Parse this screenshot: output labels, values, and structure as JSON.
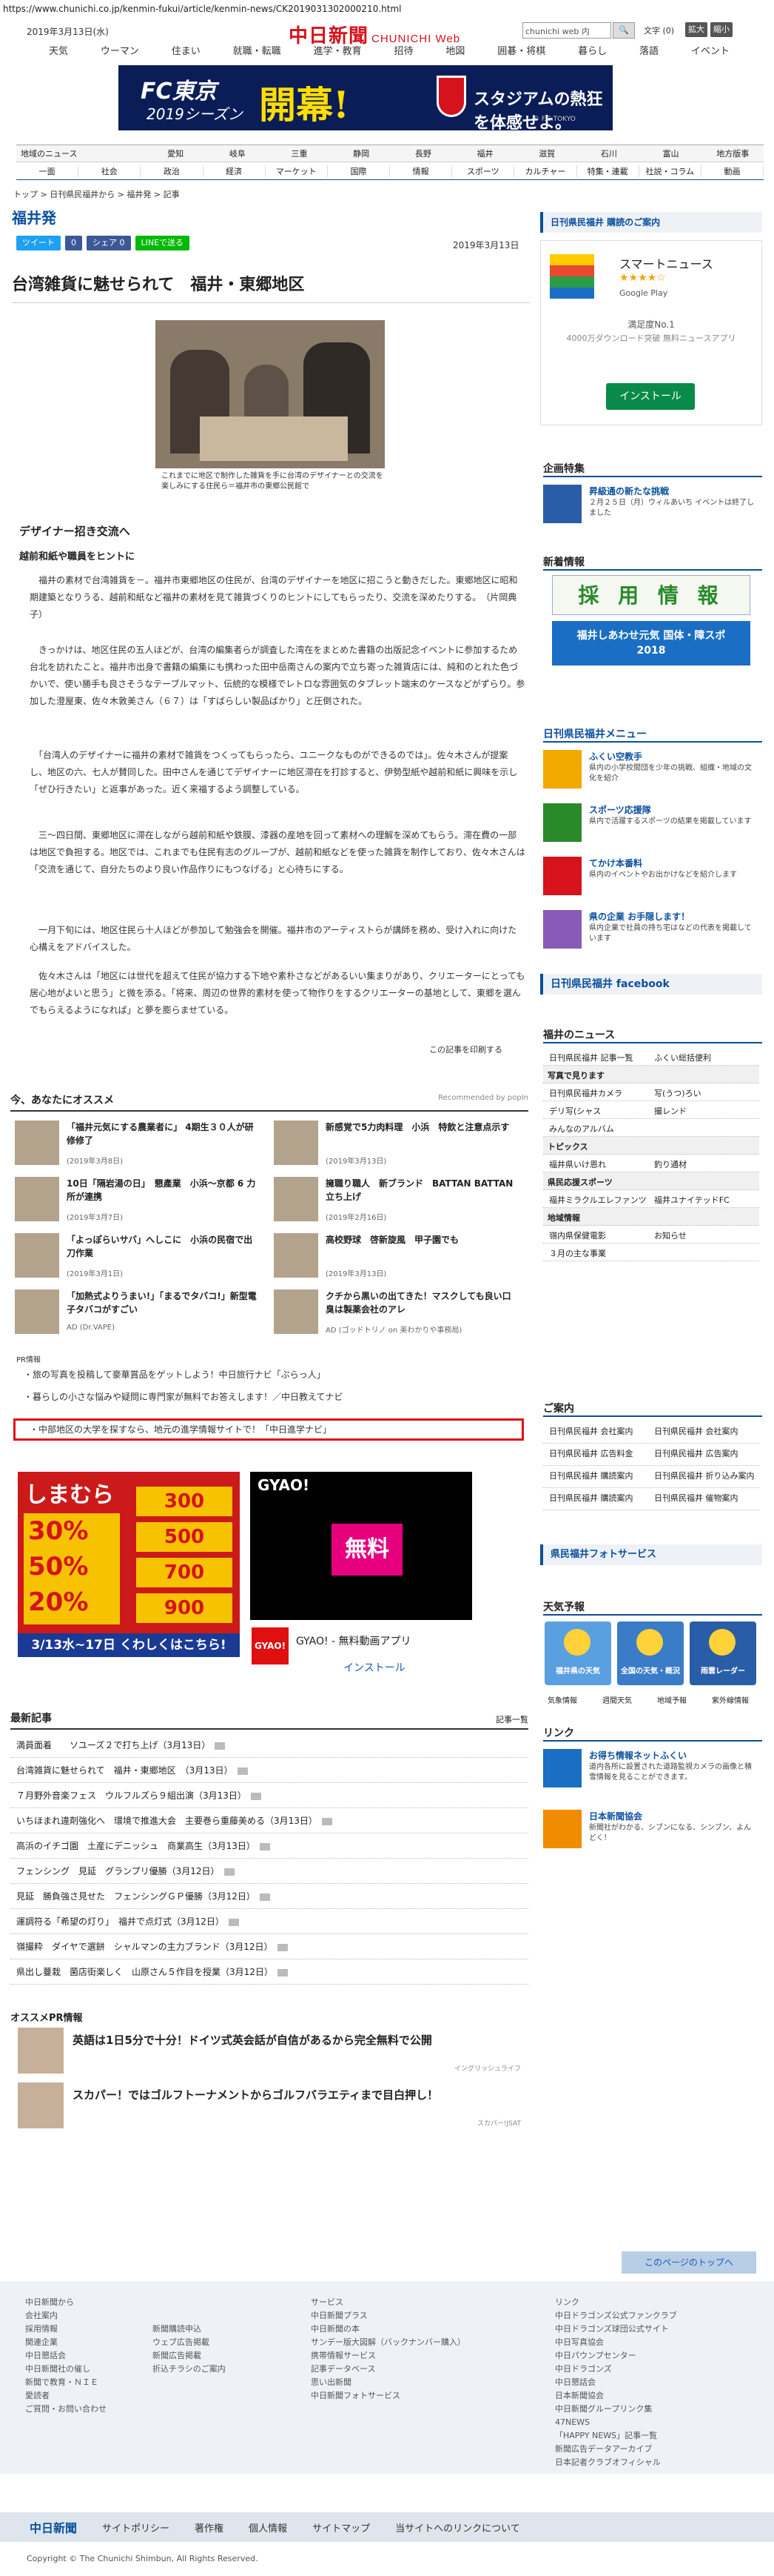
{
  "url": "https://www.chunichi.co.jp/kenmin-fukui/article/kenmin-news/CK2019031302000210.html",
  "header": {
    "date": "2019年3月13日(水)",
    "logo": "中日新聞",
    "logo_sub": "CHUNICHI Web",
    "search_value": "chunichi web 内",
    "font_size_label": "文字 (0)",
    "font_large": "拡大",
    "font_small": "縮小"
  },
  "gnav": [
    "天気",
    "ウーマン",
    "住まい",
    "就職・転職",
    "進学・教育",
    "招待",
    "地図",
    "囲碁・将棋",
    "暮らし",
    "落語",
    "イベント"
  ],
  "banner": {
    "l1": "FC東京",
    "l2": "2019シーズン",
    "l3": "開幕!",
    "l4": "スタジアムの熱狂を体感せよ。",
    "l5": "© F.C.TOKYO"
  },
  "rnav_top": [
    "地域のニュース",
    "愛知",
    "岐阜",
    "三重",
    "静岡",
    "長野",
    "福井",
    "滋賀",
    "石川",
    "富山",
    "地方版事"
  ],
  "rnav_bottom": [
    "一面",
    "社会",
    "政治",
    "経済",
    "マーケット",
    "国際",
    "情報",
    "スポーツ",
    "カルチャー",
    "特集・連載",
    "社説・コラム",
    "動画"
  ],
  "crumb": "トップ > 日刊県民福井から > 福井発 > 記事",
  "section": "福井発",
  "share": [
    {
      "label": "ツイート",
      "color": "#1da1f2"
    },
    {
      "label": "0",
      "color": "#3b5998"
    },
    {
      "label": "シェア 0",
      "color": "#3b5998"
    },
    {
      "label": "LINEで送る",
      "color": "#00b900"
    }
  ],
  "article": {
    "date": "2019年3月13日",
    "title": "台湾雑貨に魅せられて　福井・東郷地区",
    "caption": "これまでに地区で制作した雑貨を手に台湾のデザイナーとの交流を楽しみにする住民ら＝福井市の東郷公民館で",
    "h3": "デザイナー招き交流へ",
    "h4": "越前和紙や職員をヒントに",
    "paras": [
      "　福井の素材で台湾雑貨を－。福井市東郷地区の住民が、台湾のデザイナーを地区に招こうと動きだした。東郷地区に昭和期建築となりうる、越前和紙など福井の素材を見て雑貨づくりのヒントにしてもらったり、交流を深めたりする。　（片岡典子）",
      "　きっかけは、地区住民の五人ほどが、台湾の編集者らが調査した湾在をまとめた書籍の出版記念イベントに参加するため台北を訪れたこと。福井市出身で書籍の編集にも携わった田中岳南さんの案内で立ち寄った雑貨店には、純和のとれた色づかいで、使い勝手も良さそうなテーブルマット、伝統的な模様でレトロな雰囲気のタブレット端末のケースなどがずらり。参加した澄屋東、佐々木敦美さん（６７）は「すばらしい製品ばかり」と圧倒された。",
      "　「台湾人のデザイナーに福井の素材で雑貨をつくってもらったら、ユニークなものができるのでは」。佐々木さんが提案し、地区の六、七人が賛同した。田中さんを通じてデザイナーに地区滞在を打診すると、伊勢型紙や越前和紙に興味を示し「ぜひ行きたい」と返事があった。近く来福するよう調整している。",
      "　三～四日間、東郷地区に滞在しながら越前和紙や鉄膜、漆器の産地を回って素材への理解を深めてもらう。滞在費の一部は地区で負担する。地区では、これまでも住民有志のグループが、越前和紙などを使った雑貨を制作しており、佐々木さんは「交流を通じて、自分たちのより良い作品作りにもつなげる」と心待ちにする。",
      "　一月下旬には、地区住民ら十人ほどが参加して勉強会を開催。福井市のアーティストらが講師を務め、受け入れに向けた心構えをアドバイスした。",
      "　佐々木さんは「地区には世代を超えて住民が協力する下地や素朴さなどがあるいい集まりがあり、クリエーターにとっても居心地がよいと思う」と微を添る。「将来、周辺の世界的素材を使って物作りをするクリエーターの基地として、東郷を選んでもらえるようになれば」と夢を膨らませている。"
    ],
    "print": "この記事を印刷する"
  },
  "reco": {
    "title": "今、あなたにオススメ",
    "powered": "Recommended by popIn",
    "items": [
      {
        "title": "「福井元気にする農業者に」 4期生３０人が研修修了",
        "date": "(2019年3月8日)"
      },
      {
        "title": "新感覚で5力肉料理　小浜　特飲と注意点示す",
        "date": "(2019年3月13日)"
      },
      {
        "title": "10日「隔岩湯の日」　懇產業　小浜～京都 6 力所が連携",
        "date": "(2019年3月7日)"
      },
      {
        "title": "擁職り職人　新ブランド　BATTAN BATTAN立ち上げ",
        "date": "(2019年2月16日)"
      },
      {
        "title": "「よっぽらいサバ」へしこに　小浜の民宿で出刀作業",
        "date": "(2019年3月1日)"
      },
      {
        "title": "高校野球　啓新旋風　甲子園でも",
        "date": "(2019年3月13日)"
      },
      {
        "title": "「加熱式よりうまい!」「まるでタバコ!」新型電子タバコがすごい",
        "date": "AD (Dr.VAPE)"
      },
      {
        "title": "クチから黒いの出てきた！マスクしても良い口臭は製薬会社のアレ",
        "date": "AD (ゴッドトリノ on 美わかりや事務局)"
      }
    ]
  },
  "pr": {
    "label": "PR情報",
    "items": [
      "・旅の写真を投稿して豪華賞品をゲットしよう！中日旅行ナビ「ぷらっ人」",
      "・暮らしの小さな悩みや疑問に専門家が無料でお答えします！／中日教えてナビ",
      "・中部地区の大学を探すなら、地元の進学情報サイトで！「中日進学ナビ」"
    ]
  },
  "ad1": {
    "name": "しまむら",
    "p1": "30%",
    "p2": "50%",
    "p3": "20%",
    "y1": "300",
    "y2": "500",
    "y3": "700",
    "y4": "900",
    "bottom": "3/13水~17日 くわしくはこちら!"
  },
  "ad2": {
    "name": "GYAO!",
    "mid": "無料",
    "app": "GYAO! - 無料動画アプリ",
    "install": "インストール"
  },
  "latest": {
    "title": "最新記事",
    "link": "記事一覧",
    "items": [
      "満員面着　　ソユーズ２で打ち上げ（3月13日）",
      "台湾雑貨に魅せられて　福井・東郷地区　（3月13日）",
      "７月野外音楽フェス　ウルフルズら９組出演（3月13日）",
      "いちほまれ違剤強化へ　環境で推進大会　主要巻ら重藤美める（3月13日）",
      "高浜のイチゴ園　土産にデニッシュ　商業高生（3月13日）",
      "フェンシング　見延　グランプリ優勝（3月12日）",
      "見延　勝負強さ見せた　フェンシングＧＰ優勝（3月12日）",
      "運調符る「希望の灯り」　福井で点灯式（3月12日）",
      "嶺撮粋　ダイヤで選餅　シャルマンの主力ブランド（3月12日）",
      "県出し蔓栽　菌店街楽しく　山原さん５作目を授業（3月12日）"
    ]
  },
  "osusume": {
    "title": "オススメPR情報",
    "items": [
      {
        "text": "英語は1日5分で十分！ドイツ式英会話が自信があるから完全無料で公開",
        "sponsor": "イングリッシュライフ"
      },
      {
        "text": "スカパー！ではゴルフトーナメントからゴルフバラエティまで目白押し！",
        "sponsor": "スカパー!JSAT"
      }
    ]
  },
  "totop": "このページのトップへ",
  "footer": {
    "c1": [
      "中日新聞から",
      "会社案内",
      "採用情報",
      "関連企業",
      "中日懇話会",
      "中日新聞社の催し",
      "新聞で教育・ＮＩＥ",
      "愛読者",
      "ご質問・お問い合わせ"
    ],
    "c2": [
      "新聞購読申込",
      "ウェブ広告掲載",
      "新聞広告掲載",
      "折込チラシのご案内"
    ],
    "c3": [
      "サービス",
      "中日新聞プラス",
      "中日新聞の本",
      "サンデー版大図解（バックナンバー購入）",
      "携帯情報サービス",
      "記事データベース",
      "思い出新聞",
      "中日新聞フォトサービス"
    ],
    "c4": [
      "リンク",
      "中日ドラゴンズ公式ファンクラブ",
      "中日ドラゴンズ球団公式サイト",
      "中日写真協会",
      "中日パウンプセンター",
      "中日ドラゴンズ",
      "中日懇話会",
      "日本新聞協会",
      "中日新聞グループリンク集",
      "47NEWS",
      "「HAPPY NEWS」記事一覧",
      "新聞広告データアーカイブ",
      "日本記者クラブオフィシャル"
    ],
    "bar": [
      "中日新聞",
      "サイトポリシー",
      "著作権",
      "個人情報",
      "サイトマップ",
      "当サイトへのリンクについて"
    ],
    "copy": "Copyright © The Chunichi Shimbun, All Rights Reserved."
  },
  "sidebar": {
    "kenmin_banner": "日刊県民福井 購読のご案内",
    "app": {
      "name": "スマートニュース",
      "store": "Google Play",
      "stars": "★★★★☆",
      "sat": "満足度No.1",
      "dl": "4000万ダウンロード突破 無料ニュースアプリ",
      "install": "インストール"
    },
    "kikaku": "企画特集",
    "kikaku_item": {
      "title": "昇級通の新たな挑戦",
      "desc": "２月２５日（月）ウィルあいち イベントは終了しました"
    },
    "jinji": "新着情報",
    "saiyo": "採 用 情 報",
    "shiawase": "福井しあわせ元気 国体・障スポ 2018",
    "menu_title": "日刊県民福井メニュー",
    "menu": [
      {
        "t": "ふくい空教手",
        "d": "県内の小学校間団を少年の挑戦、組織・地域の文化を紹介"
      },
      {
        "t": "スポーツ応援隊",
        "d": "県内で活躍するスポーツの結果を掲載しています"
      },
      {
        "t": "てかけ本番料",
        "d": "県内のイベントやお出かけなどを紹介します"
      },
      {
        "t": "県の企業 お手隠します！",
        "d": "県内企業で社員の持ち宅はなどの代表を掲載しています"
      }
    ],
    "facebook": "日刊県民福井 facebook",
    "news_title": "福井のニュース",
    "table": [
      {
        "cat": "",
        "a": "日刊県民福井 記事一覧",
        "b": "ふくい総括便利"
      },
      {
        "cat": "写真で見ります",
        "a": "",
        "b": ""
      },
      {
        "cat": "",
        "a": "日刊県民福井カメラ",
        "b": "写(うつ)ろい"
      },
      {
        "cat": "",
        "a": "デリ写(シャス",
        "b": "撮レンド"
      },
      {
        "cat": "",
        "a": "みんなのアルバム",
        "b": ""
      },
      {
        "cat": "トピックス",
        "a": "",
        "b": ""
      },
      {
        "cat": "",
        "a": "福井県いけ恩れ",
        "b": "釣り通材"
      },
      {
        "cat": "県民応援スポーツ",
        "a": "",
        "b": ""
      },
      {
        "cat": "",
        "a": "福井ミラクルエレファンツ",
        "b": "福井ユナイテッドFC"
      },
      {
        "cat": "地域情報",
        "a": "",
        "b": ""
      },
      {
        "cat": "",
        "a": "嶺内県保健電影",
        "b": "お知らせ"
      },
      {
        "cat": "",
        "a": "３月の主な事業",
        "b": ""
      }
    ],
    "annai": "ご案内",
    "annai_rows": [
      [
        "日刊県民福井 会社案内",
        "日刊県民福井 会社案内"
      ],
      [
        "日刊県民福井 広告料金",
        "日刊県民福井 広告案内"
      ],
      [
        "日刊県民福井 購読案内",
        "日刊県民福井 折り込み案内"
      ],
      [
        "日刊県民福井 購読案内",
        "日刊県民福井 催物案内"
      ]
    ],
    "photo_svc": "県民福井フォトサービス",
    "tenki": "天気予報",
    "tenki_items": [
      "福井県の天気",
      "全国の天気・概況",
      "雨雲レーダー"
    ],
    "tenki_links": [
      "気象情報",
      "週間天気",
      "地域予報",
      "紫外線情報"
    ],
    "link_title": "リンク",
    "link1": {
      "t": "お得ち情報ネットふくい",
      "d": "道内各所に設置された道路監視カメラの画像と積雪情報を見ることができます。"
    },
    "link2": {
      "t": "日本新聞協会",
      "d": "新聞社がわかる、シブンになる、シンブン、よんどく！"
    }
  }
}
